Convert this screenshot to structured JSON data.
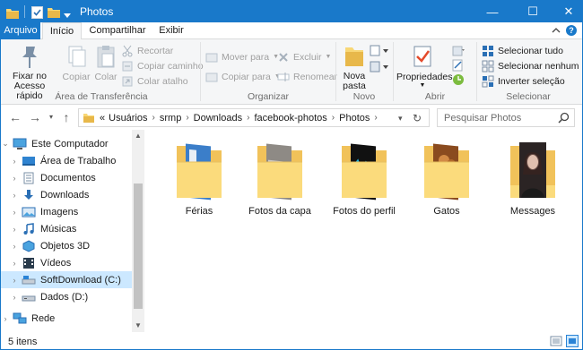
{
  "window": {
    "title": "Photos",
    "minimize_glyph": "—",
    "maximize_glyph": "☐",
    "close_glyph": "✕",
    "accent": "#1979ca"
  },
  "tabs": {
    "file": "Arquivo",
    "home": "Início",
    "share": "Compartilhar",
    "view": "Exibir",
    "help_glyph": "?"
  },
  "ribbon": {
    "clipboard": {
      "pin": "Fixar no Acesso rápido",
      "copy": "Copiar",
      "paste": "Colar",
      "cut": "Recortar",
      "copy_path": "Copiar caminho",
      "paste_shortcut": "Colar atalho",
      "label": "Área de Transferência"
    },
    "organize": {
      "move_to": "Mover para",
      "copy_to": "Copiar para",
      "delete": "Excluir",
      "rename": "Renomear",
      "label": "Organizar"
    },
    "new": {
      "new_folder": "Nova pasta",
      "label": "Novo"
    },
    "open": {
      "properties": "Propriedades",
      "label": "Abrir"
    },
    "select": {
      "select_all": "Selecionar tudo",
      "select_none": "Selecionar nenhum",
      "invert": "Inverter seleção",
      "label": "Selecionar"
    }
  },
  "address": {
    "overflow": "«",
    "crumbs": [
      "Usuários",
      "srmp",
      "Downloads",
      "facebook-photos",
      "Photos"
    ],
    "search_placeholder": "Pesquisar Photos"
  },
  "nav": {
    "items": [
      {
        "label": "Este Computador",
        "icon": "computer-icon"
      },
      {
        "label": "Área de Trabalho",
        "icon": "desktop-icon"
      },
      {
        "label": "Documentos",
        "icon": "documents-icon"
      },
      {
        "label": "Downloads",
        "icon": "downloads-icon"
      },
      {
        "label": "Imagens",
        "icon": "pictures-icon"
      },
      {
        "label": "Músicas",
        "icon": "music-icon"
      },
      {
        "label": "Objetos 3D",
        "icon": "objects-3d-icon"
      },
      {
        "label": "Vídeos",
        "icon": "videos-icon"
      },
      {
        "label": "SoftDownload (C:)",
        "icon": "drive-c-icon"
      },
      {
        "label": "Dados (D:)",
        "icon": "drive-d-icon"
      },
      {
        "label": "Rede",
        "icon": "network-icon"
      }
    ]
  },
  "folders": [
    {
      "name": "Férias"
    },
    {
      "name": "Fotos da capa"
    },
    {
      "name": "Fotos do perfil"
    },
    {
      "name": "Gatos"
    },
    {
      "name": "Messages"
    }
  ],
  "status": {
    "count": "5 itens"
  }
}
